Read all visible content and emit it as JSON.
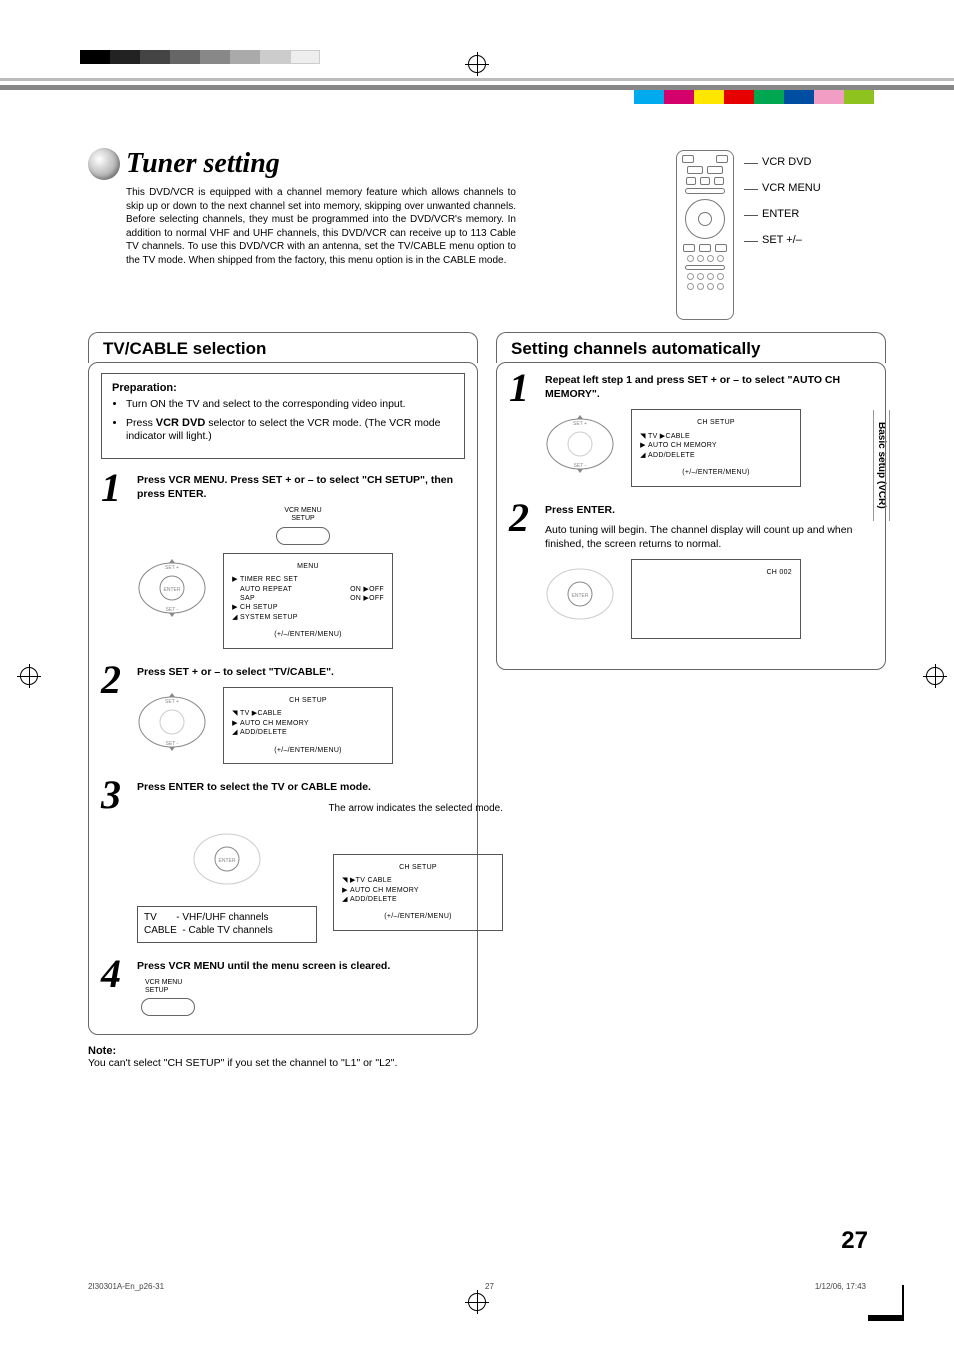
{
  "title": "Tuner setting",
  "intro": "This DVD/VCR is equipped with a channel memory feature which allows channels to skip up or down to the next channel set into memory, skipping over unwanted channels. Before selecting channels, they must be programmed into the DVD/VCR's memory. In addition to normal VHF and UHF channels, this DVD/VCR can receive up to 113 Cable TV channels. To use this DVD/VCR with an antenna, set the TV/CABLE menu option to the TV mode. When shipped from the factory, this menu option is in the CABLE mode.",
  "remote": {
    "l1": "VCR DVD",
    "l2": "VCR MENU",
    "l3": "ENTER",
    "l4": "SET +/–"
  },
  "left": {
    "heading": "TV/CABLE selection",
    "prep_title": "Preparation:",
    "prep_items": [
      "Turn ON the TV and select to the corresponding video input.",
      "Press VCR DVD selector to select the VCR mode. (The VCR mode indicator will light.)"
    ],
    "prep_bold": "VCR DVD",
    "s1": {
      "n": "1",
      "head": "Press VCR MENU. Press SET + or – to select \"CH SETUP\", then press ENTER.",
      "btn_lbl": "VCR MENU\nSETUP",
      "osd": {
        "title": "MENU",
        "rows": [
          {
            "m": "▶",
            "t": "TIMER REC SET"
          },
          {
            "m": "",
            "t": "AUTO REPEAT",
            "r": "ON ▶OFF"
          },
          {
            "m": "",
            "t": "SAP",
            "r": "ON ▶OFF"
          },
          {
            "m": "▶",
            "t": "CH SETUP"
          },
          {
            "m": "◢",
            "t": "SYSTEM SETUP"
          }
        ],
        "footer": "(+/–/ENTER/MENU)"
      }
    },
    "s2": {
      "n": "2",
      "head": "Press SET + or – to select \"TV/CABLE\".",
      "osd": {
        "title": "CH SETUP",
        "rows": [
          {
            "m": "◥",
            "t": "TV  ▶CABLE"
          },
          {
            "m": "▶",
            "t": "AUTO CH MEMORY"
          },
          {
            "m": "◢",
            "t": "ADD/DELETE"
          }
        ],
        "footer": "(+/–/ENTER/MENU)"
      }
    },
    "s3": {
      "n": "3",
      "head": "Press ENTER to select the TV or CABLE mode.",
      "sub": "The arrow indicates the selected mode.",
      "osd": {
        "title": "CH SETUP",
        "rows": [
          {
            "m": "◥",
            "t": "▶TV   CABLE"
          },
          {
            "m": "▶",
            "t": "AUTO CH MEMORY"
          },
          {
            "m": "◢",
            "t": "ADD/DELETE"
          }
        ],
        "footer": "(+/–/ENTER/MENU)"
      },
      "info1": "TV",
      "info1b": "- VHF/UHF channels",
      "info2": "CABLE",
      "info2b": "- Cable TV channels"
    },
    "s4": {
      "n": "4",
      "head": "Press VCR MENU until the menu screen is cleared.",
      "btn_lbl": "VCR MENU\nSETUP"
    }
  },
  "right": {
    "heading": "Setting channels automatically",
    "s1": {
      "n": "1",
      "head": "Repeat left step 1 and press SET + or – to select \"AUTO CH MEMORY\".",
      "osd": {
        "title": "CH SETUP",
        "rows": [
          {
            "m": "◥",
            "t": "TV  ▶CABLE"
          },
          {
            "m": "▶",
            "t": "AUTO CH MEMORY"
          },
          {
            "m": "◢",
            "t": "ADD/DELETE"
          }
        ],
        "footer": "(+/–/ENTER/MENU)"
      }
    },
    "s2": {
      "n": "2",
      "head": "Press ENTER.",
      "body": "Auto tuning will begin. The channel display will count up and when finished, the screen returns to normal.",
      "osd_simple": "CH 002"
    }
  },
  "note": {
    "h": "Note:",
    "t": "You can't select \"CH SETUP\" if you set the channel to \"L1\" or \"L2\"."
  },
  "side_tab": "Basic setup (VCR)",
  "page_num": "27",
  "footer": {
    "l": "2I30301A-En_p26-31",
    "c": "27",
    "r": "1/12/06, 17:43"
  }
}
